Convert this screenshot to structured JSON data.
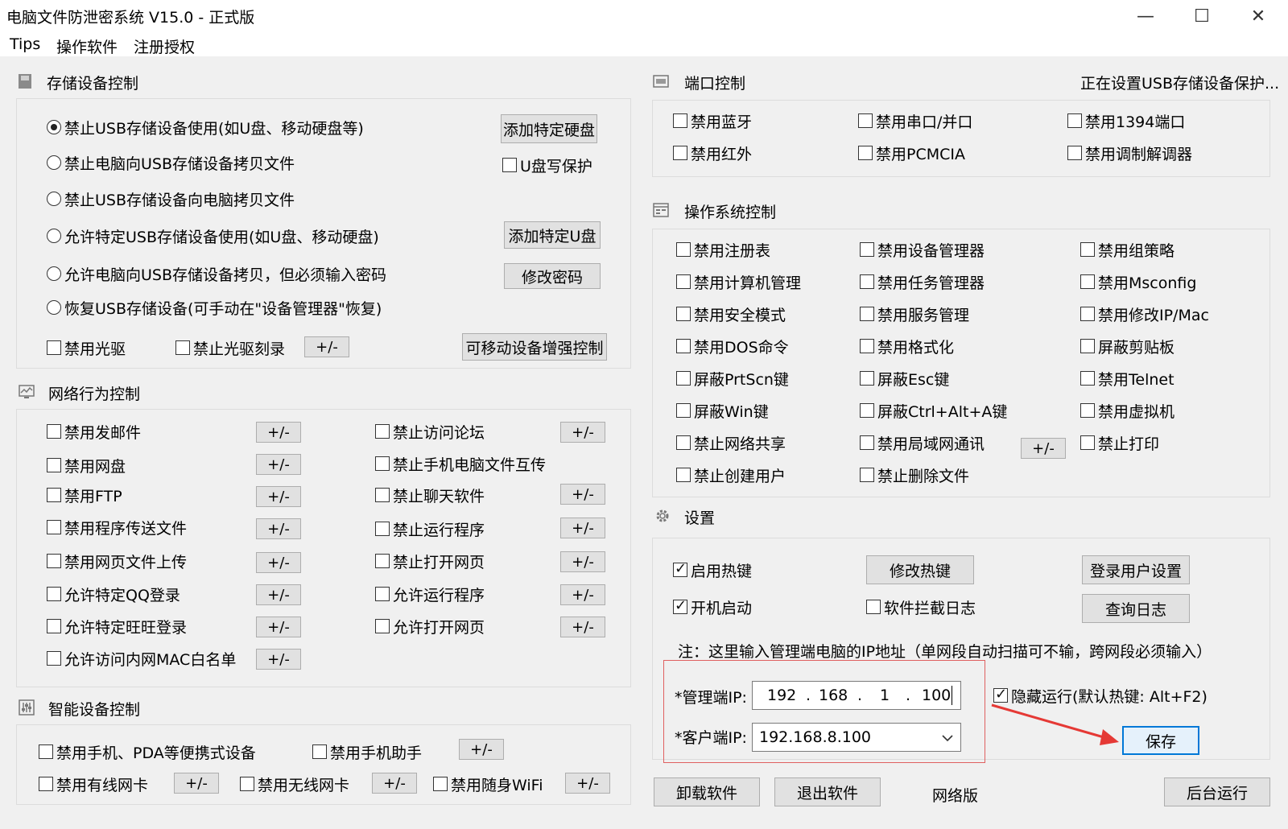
{
  "window": {
    "title": "电脑文件防泄密系统 V15.0 - 正式版",
    "minimize": "—",
    "maximize": "☐",
    "close": "✕"
  },
  "menu": [
    "Tips",
    "操作软件",
    "注册授权"
  ],
  "storage": {
    "title": "存储设备控制",
    "radios": [
      "禁止USB存储设备使用(如U盘、移动硬盘等)",
      "禁止电脑向USB存储设备拷贝文件",
      "禁止USB存储设备向电脑拷贝文件",
      "允许特定USB存储设备使用(如U盘、移动硬盘)",
      "允许电脑向USB存储设备拷贝，但必须输入密码",
      "恢复USB存储设备(可手动在\"设备管理器\"恢复)"
    ],
    "add_disk": "添加特定硬盘",
    "usb_write_protect": "U盘写保护",
    "add_usb": "添加特定U盘",
    "change_pwd": "修改密码",
    "disable_cdrom": "禁用光驱",
    "disable_burn": "禁止光驱刻录",
    "pm": "+/-",
    "enhanced": "可移动设备增强控制"
  },
  "network": {
    "title": "网络行为控制",
    "left": [
      "禁用发邮件",
      "禁用网盘",
      "禁用FTP",
      "禁用程序传送文件",
      "禁用网页文件上传",
      "允许特定QQ登录",
      "允许特定旺旺登录",
      "允许访问内网MAC白名单"
    ],
    "right": [
      "禁止访问论坛",
      "禁止手机电脑文件互传",
      "禁止聊天软件",
      "禁止运行程序",
      "禁止打开网页",
      "允许运行程序",
      "允许打开网页"
    ]
  },
  "smart": {
    "title": "智能设备控制",
    "items": [
      "禁用手机、PDA等便携式设备",
      "禁用手机助手",
      "禁用有线网卡",
      "禁用无线网卡",
      "禁用随身WiFi"
    ]
  },
  "port": {
    "title": "端口控制",
    "status": "正在设置USB存储设备保护...",
    "items": [
      "禁用蓝牙",
      "禁用串口/并口",
      "禁用1394端口",
      "禁用红外",
      "禁用PCMCIA",
      "禁用调制解调器"
    ]
  },
  "os": {
    "title": "操作系统控制",
    "col1": [
      "禁用注册表",
      "禁用计算机管理",
      "禁用安全模式",
      "禁用DOS命令",
      "屏蔽PrtScn键",
      "屏蔽Win键",
      "禁止网络共享",
      "禁止创建用户"
    ],
    "col2": [
      "禁用设备管理器",
      "禁用任务管理器",
      "禁用服务管理",
      "禁用格式化",
      "屏蔽Esc键",
      "屏蔽Ctrl+Alt+A键",
      "禁用局域网通讯",
      "禁止删除文件"
    ],
    "col3": [
      "禁用组策略",
      "禁用Msconfig",
      "禁用修改IP/Mac",
      "屏蔽剪贴板",
      "禁用Telnet",
      "禁用虚拟机",
      "禁止打印"
    ]
  },
  "settings": {
    "title": "设置",
    "hotkey": "启用热键",
    "change_hotkey": "修改热键",
    "login_settings": "登录用户设置",
    "autostart": "开机启动",
    "intercept_log": "软件拦截日志",
    "query_log": "查询日志",
    "note": "注：这里输入管理端电脑的IP地址（单网段自动扫描可不输，跨网段必须输入）",
    "admin_ip_label": "*管理端IP:",
    "admin_ip": [
      "192",
      "168",
      "1",
      "100"
    ],
    "ip_dot": ".",
    "client_ip_label": "*客户端IP:",
    "client_ip": "192.168.8.100",
    "hide_run": "隐藏运行(默认热键: Alt+F2)",
    "save": "保存"
  },
  "bottom": {
    "uninstall": "卸载软件",
    "exit": "退出软件",
    "edition": "网络版",
    "background": "后台运行"
  },
  "colors": {
    "red_frame": "#e06060",
    "arrow": "#e53935",
    "save_border": "#0078d7"
  }
}
